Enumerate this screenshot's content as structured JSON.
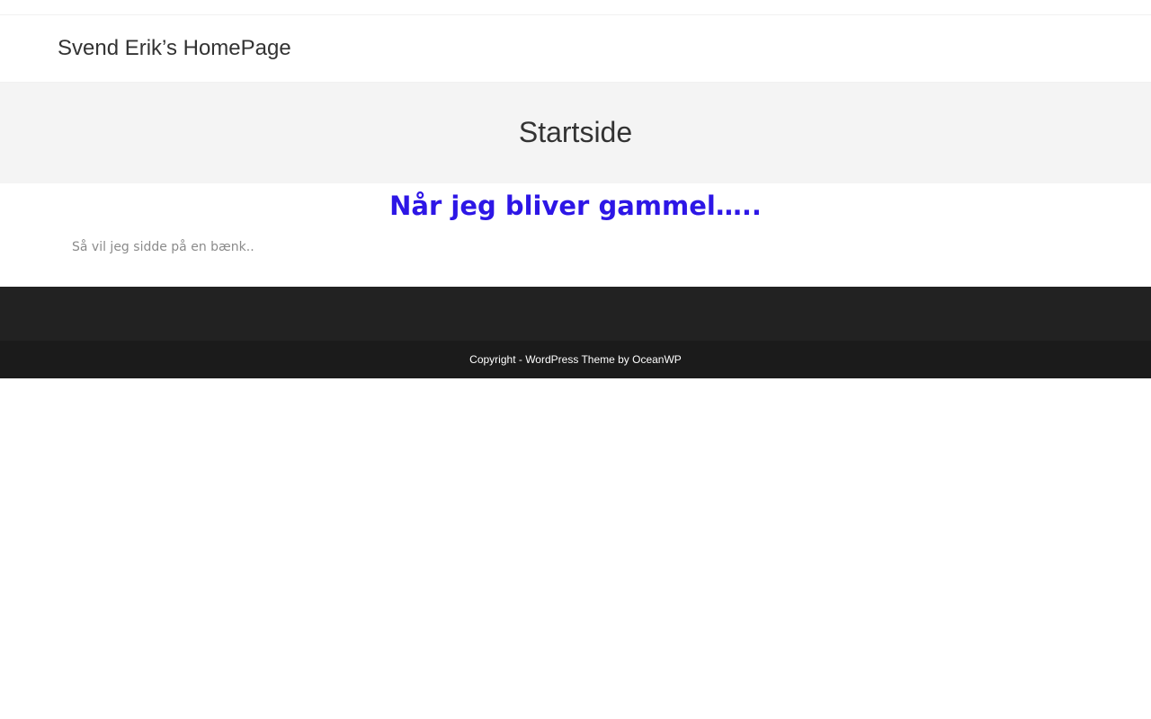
{
  "header": {
    "site_title": "Svend Erik’s HomePage"
  },
  "page": {
    "title": "Startside"
  },
  "content": {
    "heading": "Når jeg bliver gammel…..",
    "text": "Så vil jeg sidde på en bænk.."
  },
  "footer": {
    "copyright": "Copyright - WordPress Theme by OceanWP"
  },
  "colors": {
    "heading": "#2d16e6",
    "page_header_bg": "#f4f4f4",
    "footer_widgets_bg": "#222222",
    "footer_bottom_bg": "#1b1b1b"
  }
}
